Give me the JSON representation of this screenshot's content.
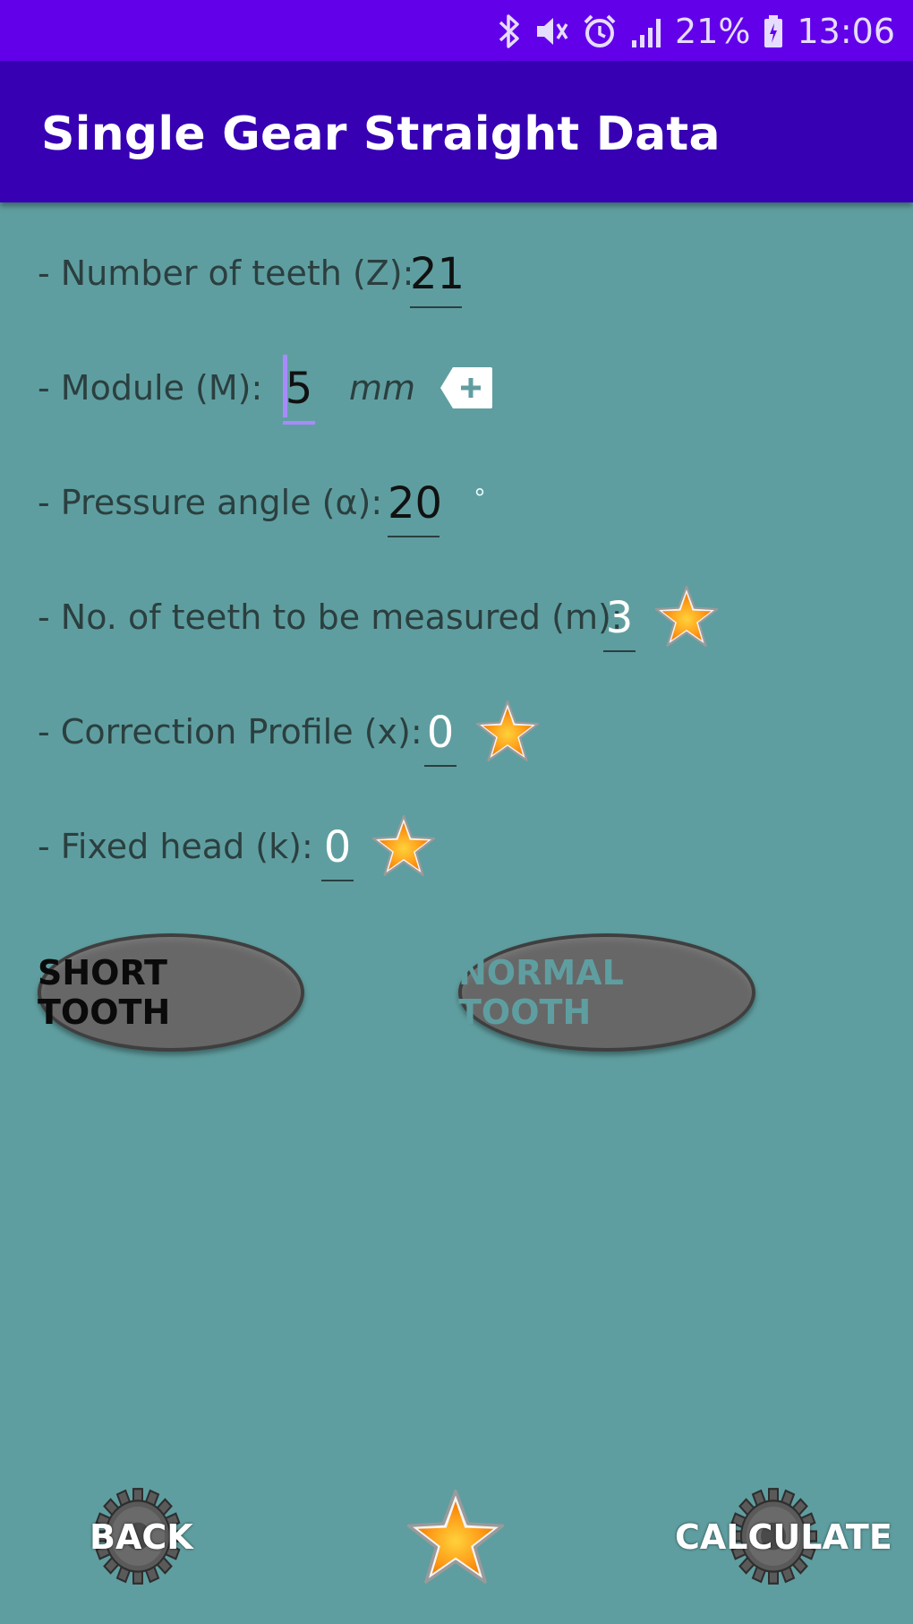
{
  "status": {
    "battery": "21%",
    "time": "13:06"
  },
  "appbar": {
    "title": "Single Gear Straight Data"
  },
  "form": {
    "teeth": {
      "label": "- Number of teeth (Z):",
      "value": "21"
    },
    "module": {
      "label": "- Module (M):",
      "value": "5",
      "unit": "mm"
    },
    "pressure": {
      "label": "- Pressure angle (α):",
      "value": "20",
      "unit": "°"
    },
    "measured": {
      "label": "- No. of teeth to be measured (m):",
      "value": "3"
    },
    "correction": {
      "label": "- Correction Profile (x):",
      "value": "0"
    },
    "fixed_head": {
      "label": "- Fixed head (k):",
      "value": "0"
    }
  },
  "buttons": {
    "short_tooth": "SHORT TOOTH",
    "normal_tooth": "NORMAL TOOTH"
  },
  "bottom": {
    "back": "BACK",
    "calculate": "CALCULATE"
  },
  "colors": {
    "status_bar": "#6200ea",
    "app_bar": "#3700b3",
    "background": "#5f9ea0",
    "pill": "#676767"
  },
  "icons": [
    "bluetooth-icon",
    "mute-icon",
    "alarm-icon",
    "signal-icon",
    "battery-icon",
    "keyboard-plus-icon",
    "star-icon",
    "gear-icon"
  ]
}
